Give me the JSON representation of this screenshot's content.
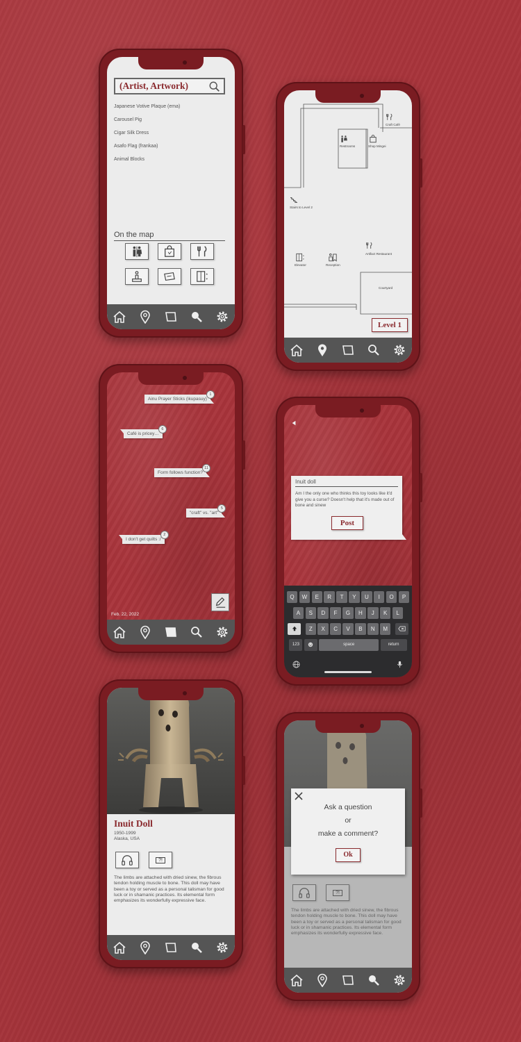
{
  "search": {
    "placeholder": "(Artist, Artwork)",
    "results": [
      "Japanese Votive Plaque (ema)",
      "Carousel Pig",
      "Cigar Silk Dress",
      "Asafo Flag (frankaa)",
      "Animal Blocks"
    ],
    "on_map_label": "On the map"
  },
  "map": {
    "labels": {
      "craft_cafe": "Craft Café",
      "restrooms": "Restrooms",
      "shop_mingei": "Shop Mingei",
      "stairs": "Stairs to Level 2",
      "elevator": "Elevator",
      "reception": "Reception",
      "artifact_restaurant": "Artifact Restaurant",
      "courtyard": "Courtyard"
    },
    "level_button": "Level 1"
  },
  "comments": {
    "bubbles": [
      {
        "text": "Ainu Prayer Sticks (ikupasuy)",
        "count": "1"
      },
      {
        "text": "Café is pricey…",
        "count": "6"
      },
      {
        "text": "Form follows function?",
        "count": "11"
      },
      {
        "text": "\"craft\" vs. \"art\"",
        "count": "5"
      },
      {
        "text": "I don't get quilts :/",
        "count": "2"
      }
    ],
    "date": "Feb. 22, 2022"
  },
  "compose": {
    "title": "Inuit doll",
    "text": "Am I the only one who thinks this toy looks like it'd give you a curse? Doesn't help that it's made out of bone and sinew",
    "post_label": "Post",
    "keyboard": {
      "row1": [
        "Q",
        "W",
        "E",
        "R",
        "T",
        "Y",
        "U",
        "I",
        "O",
        "P"
      ],
      "row2": [
        "A",
        "S",
        "D",
        "F",
        "G",
        "H",
        "J",
        "K",
        "L"
      ],
      "row3": [
        "Z",
        "X",
        "C",
        "V",
        "B",
        "N",
        "M"
      ],
      "num_key": "123",
      "space_key": "space",
      "return_key": "return"
    }
  },
  "artwork": {
    "title": "Inuit Doll",
    "dates": "1950-1999",
    "location": "Alaska, USA",
    "info_button": "?!",
    "description": "The limbs are attached with dried sinew, the fibrous tendon holding muscle to bone. This doll may have been a toy or served as a personal talisman for good luck or in shamanic practices. Its elemental form emphasizes its wonderfully expressive face."
  },
  "modal": {
    "line1": "Ask a question",
    "line2": "or",
    "line3": "make a comment?",
    "ok_label": "Ok"
  },
  "colors": {
    "accent": "#8a2a2e",
    "background": "#a8343b",
    "navbar": "#555555",
    "phone": "#7a1c22"
  },
  "icons": [
    "home-icon",
    "location-pin-icon",
    "board-icon",
    "search-icon",
    "gear-icon"
  ]
}
